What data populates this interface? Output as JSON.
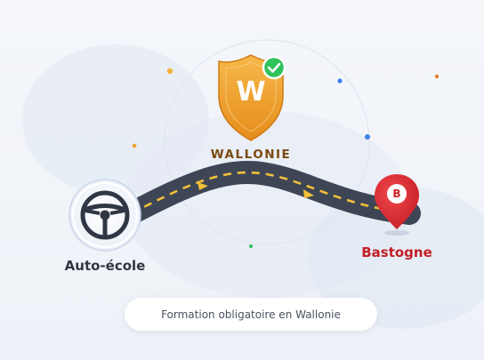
{
  "region": {
    "shield_letter": "W",
    "name": "WALLONIE",
    "badge": "check-icon"
  },
  "route": {
    "start_label": "Auto-école",
    "start_icon": "steering-wheel-icon",
    "end_label": "Bastogne",
    "end_pin_letter": "B",
    "end_icon": "map-pin-icon"
  },
  "caption": "Formation obligatoire en Wallonie",
  "colors": {
    "shield_orange": "#f2a437",
    "check_green": "#2ec25b",
    "road": "#3e4656",
    "road_dash": "#f2c037",
    "pin_red": "#de2c33",
    "wheel": "#2f3644",
    "end_label": "#c41e25",
    "region_label": "#7a4a12"
  }
}
